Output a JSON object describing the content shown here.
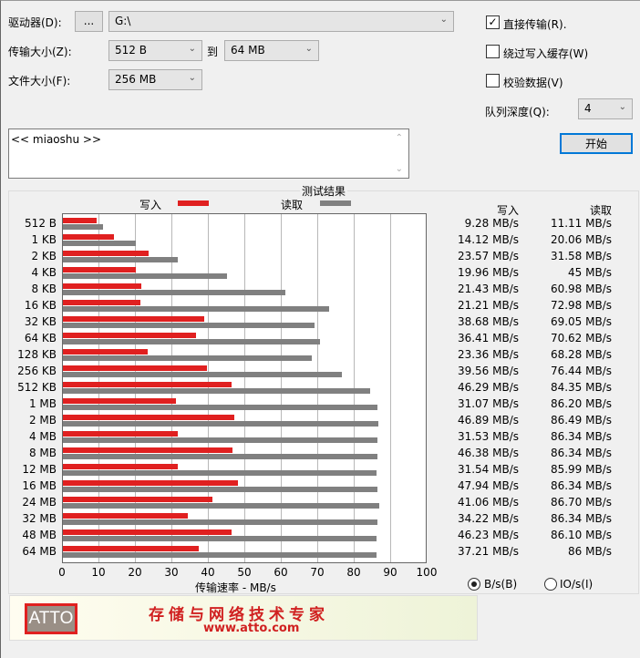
{
  "controls": {
    "drive_label": "驱动器(D):",
    "browse_label": "...",
    "drive_value": "G:\\",
    "transfer_label": "传输大小(Z):",
    "transfer_from": "512 B",
    "to_label": "到",
    "transfer_to": "64 MB",
    "file_label": "文件大小(F):",
    "file_value": "256 MB",
    "direct_io": "直接传输(R).",
    "direct_io_checked": true,
    "bypass_cache": "绕过写入缓存(W)",
    "bypass_checked": false,
    "verify": "校验数据(V)",
    "verify_checked": false,
    "queue_label": "队列深度(Q):",
    "queue_value": "4",
    "start_button": "开始",
    "description": "<< miaoshu >>"
  },
  "results": {
    "group_title": "测试结果",
    "write_legend": "写入",
    "read_legend": "读取",
    "write_header": "写入",
    "read_header": "读取",
    "units_bytes": "B/s(B)",
    "units_io": "IO/s(I)",
    "units_selected": "bytes"
  },
  "colors": {
    "write": "#e02020",
    "read": "#808080"
  },
  "chart_data": {
    "type": "bar",
    "orientation": "horizontal",
    "xlabel": "传输速率 - MB/s",
    "xlim": [
      0,
      100
    ],
    "xticks": [
      "0",
      "10",
      "20",
      "30",
      "40",
      "50",
      "60",
      "70",
      "80",
      "90",
      "100"
    ],
    "categories": [
      "512 B",
      "1 KB",
      "2 KB",
      "4 KB",
      "8 KB",
      "16 KB",
      "32 KB",
      "64 KB",
      "128 KB",
      "256 KB",
      "512 KB",
      "1 MB",
      "2 MB",
      "4 MB",
      "8 MB",
      "12 MB",
      "16 MB",
      "24 MB",
      "32 MB",
      "48 MB",
      "64 MB"
    ],
    "series": [
      {
        "name": "写入",
        "values": [
          9.28,
          14.12,
          23.57,
          19.96,
          21.43,
          21.21,
          38.68,
          36.41,
          23.36,
          39.56,
          46.29,
          31.07,
          46.89,
          31.53,
          46.38,
          31.54,
          47.94,
          41.06,
          34.22,
          46.23,
          37.21
        ],
        "labels": [
          "9.28 MB/s",
          "14.12 MB/s",
          "23.57 MB/s",
          "19.96 MB/s",
          "21.43 MB/s",
          "21.21 MB/s",
          "38.68 MB/s",
          "36.41 MB/s",
          "23.36 MB/s",
          "39.56 MB/s",
          "46.29 MB/s",
          "31.07 MB/s",
          "46.89 MB/s",
          "31.53 MB/s",
          "46.38 MB/s",
          "31.54 MB/s",
          "47.94 MB/s",
          "41.06 MB/s",
          "34.22 MB/s",
          "46.23 MB/s",
          "37.21 MB/s"
        ]
      },
      {
        "name": "读取",
        "values": [
          11.11,
          20.06,
          31.58,
          45,
          60.98,
          72.98,
          69.05,
          70.62,
          68.28,
          76.44,
          84.35,
          86.2,
          86.49,
          86.34,
          86.34,
          85.99,
          86.34,
          86.7,
          86.34,
          86.1,
          86
        ],
        "labels": [
          "11.11 MB/s",
          "20.06 MB/s",
          "31.58 MB/s",
          "45 MB/s",
          "60.98 MB/s",
          "72.98 MB/s",
          "69.05 MB/s",
          "70.62 MB/s",
          "68.28 MB/s",
          "76.44 MB/s",
          "84.35 MB/s",
          "86.20 MB/s",
          "86.49 MB/s",
          "86.34 MB/s",
          "86.34 MB/s",
          "85.99 MB/s",
          "86.34 MB/s",
          "86.70 MB/s",
          "86.34 MB/s",
          "86.10 MB/s",
          "86 MB/s"
        ]
      }
    ]
  },
  "banner": {
    "logo": "ATTO",
    "slogan": "存储与网络技术专家",
    "url": "www.atto.com"
  }
}
